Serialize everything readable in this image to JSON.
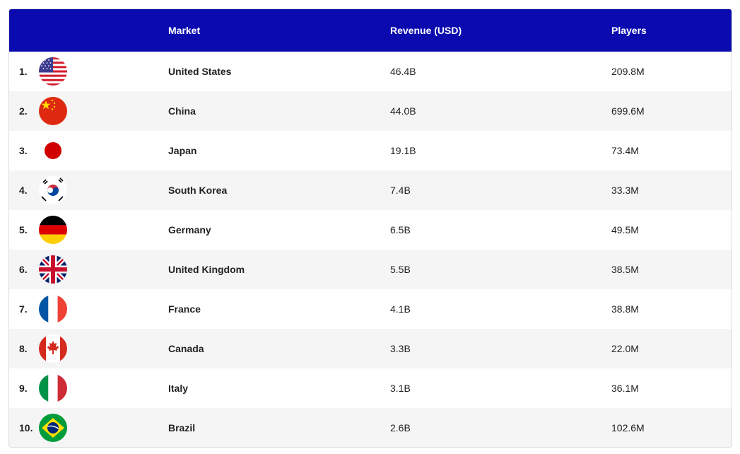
{
  "header": {
    "market": "Market",
    "revenue": "Revenue (USD)",
    "players": "Players"
  },
  "colors": {
    "header_bg": "#0a0aaf",
    "row_alt_bg": "#f5f5f5"
  },
  "rows": [
    {
      "rank": "1.",
      "flag_icon": "us-flag-icon",
      "market": "United States",
      "revenue": "46.4B",
      "players": "209.8M"
    },
    {
      "rank": "2.",
      "flag_icon": "china-flag-icon",
      "market": "China",
      "revenue": "44.0B",
      "players": "699.6M"
    },
    {
      "rank": "3.",
      "flag_icon": "japan-flag-icon",
      "market": "Japan",
      "revenue": "19.1B",
      "players": "73.4M"
    },
    {
      "rank": "4.",
      "flag_icon": "south-korea-flag-icon",
      "market": "South Korea",
      "revenue": "7.4B",
      "players": "33.3M"
    },
    {
      "rank": "5.",
      "flag_icon": "germany-flag-icon",
      "market": "Germany",
      "revenue": "6.5B",
      "players": "49.5M"
    },
    {
      "rank": "6.",
      "flag_icon": "uk-flag-icon",
      "market": "United Kingdom",
      "revenue": "5.5B",
      "players": "38.5M"
    },
    {
      "rank": "7.",
      "flag_icon": "france-flag-icon",
      "market": "France",
      "revenue": "4.1B",
      "players": "38.8M"
    },
    {
      "rank": "8.",
      "flag_icon": "canada-flag-icon",
      "market": "Canada",
      "revenue": "3.3B",
      "players": "22.0M"
    },
    {
      "rank": "9.",
      "flag_icon": "italy-flag-icon",
      "market": "Italy",
      "revenue": "3.1B",
      "players": "36.1M"
    },
    {
      "rank": "10.",
      "flag_icon": "brazil-flag-icon",
      "market": "Brazil",
      "revenue": "2.6B",
      "players": "102.6M"
    }
  ]
}
